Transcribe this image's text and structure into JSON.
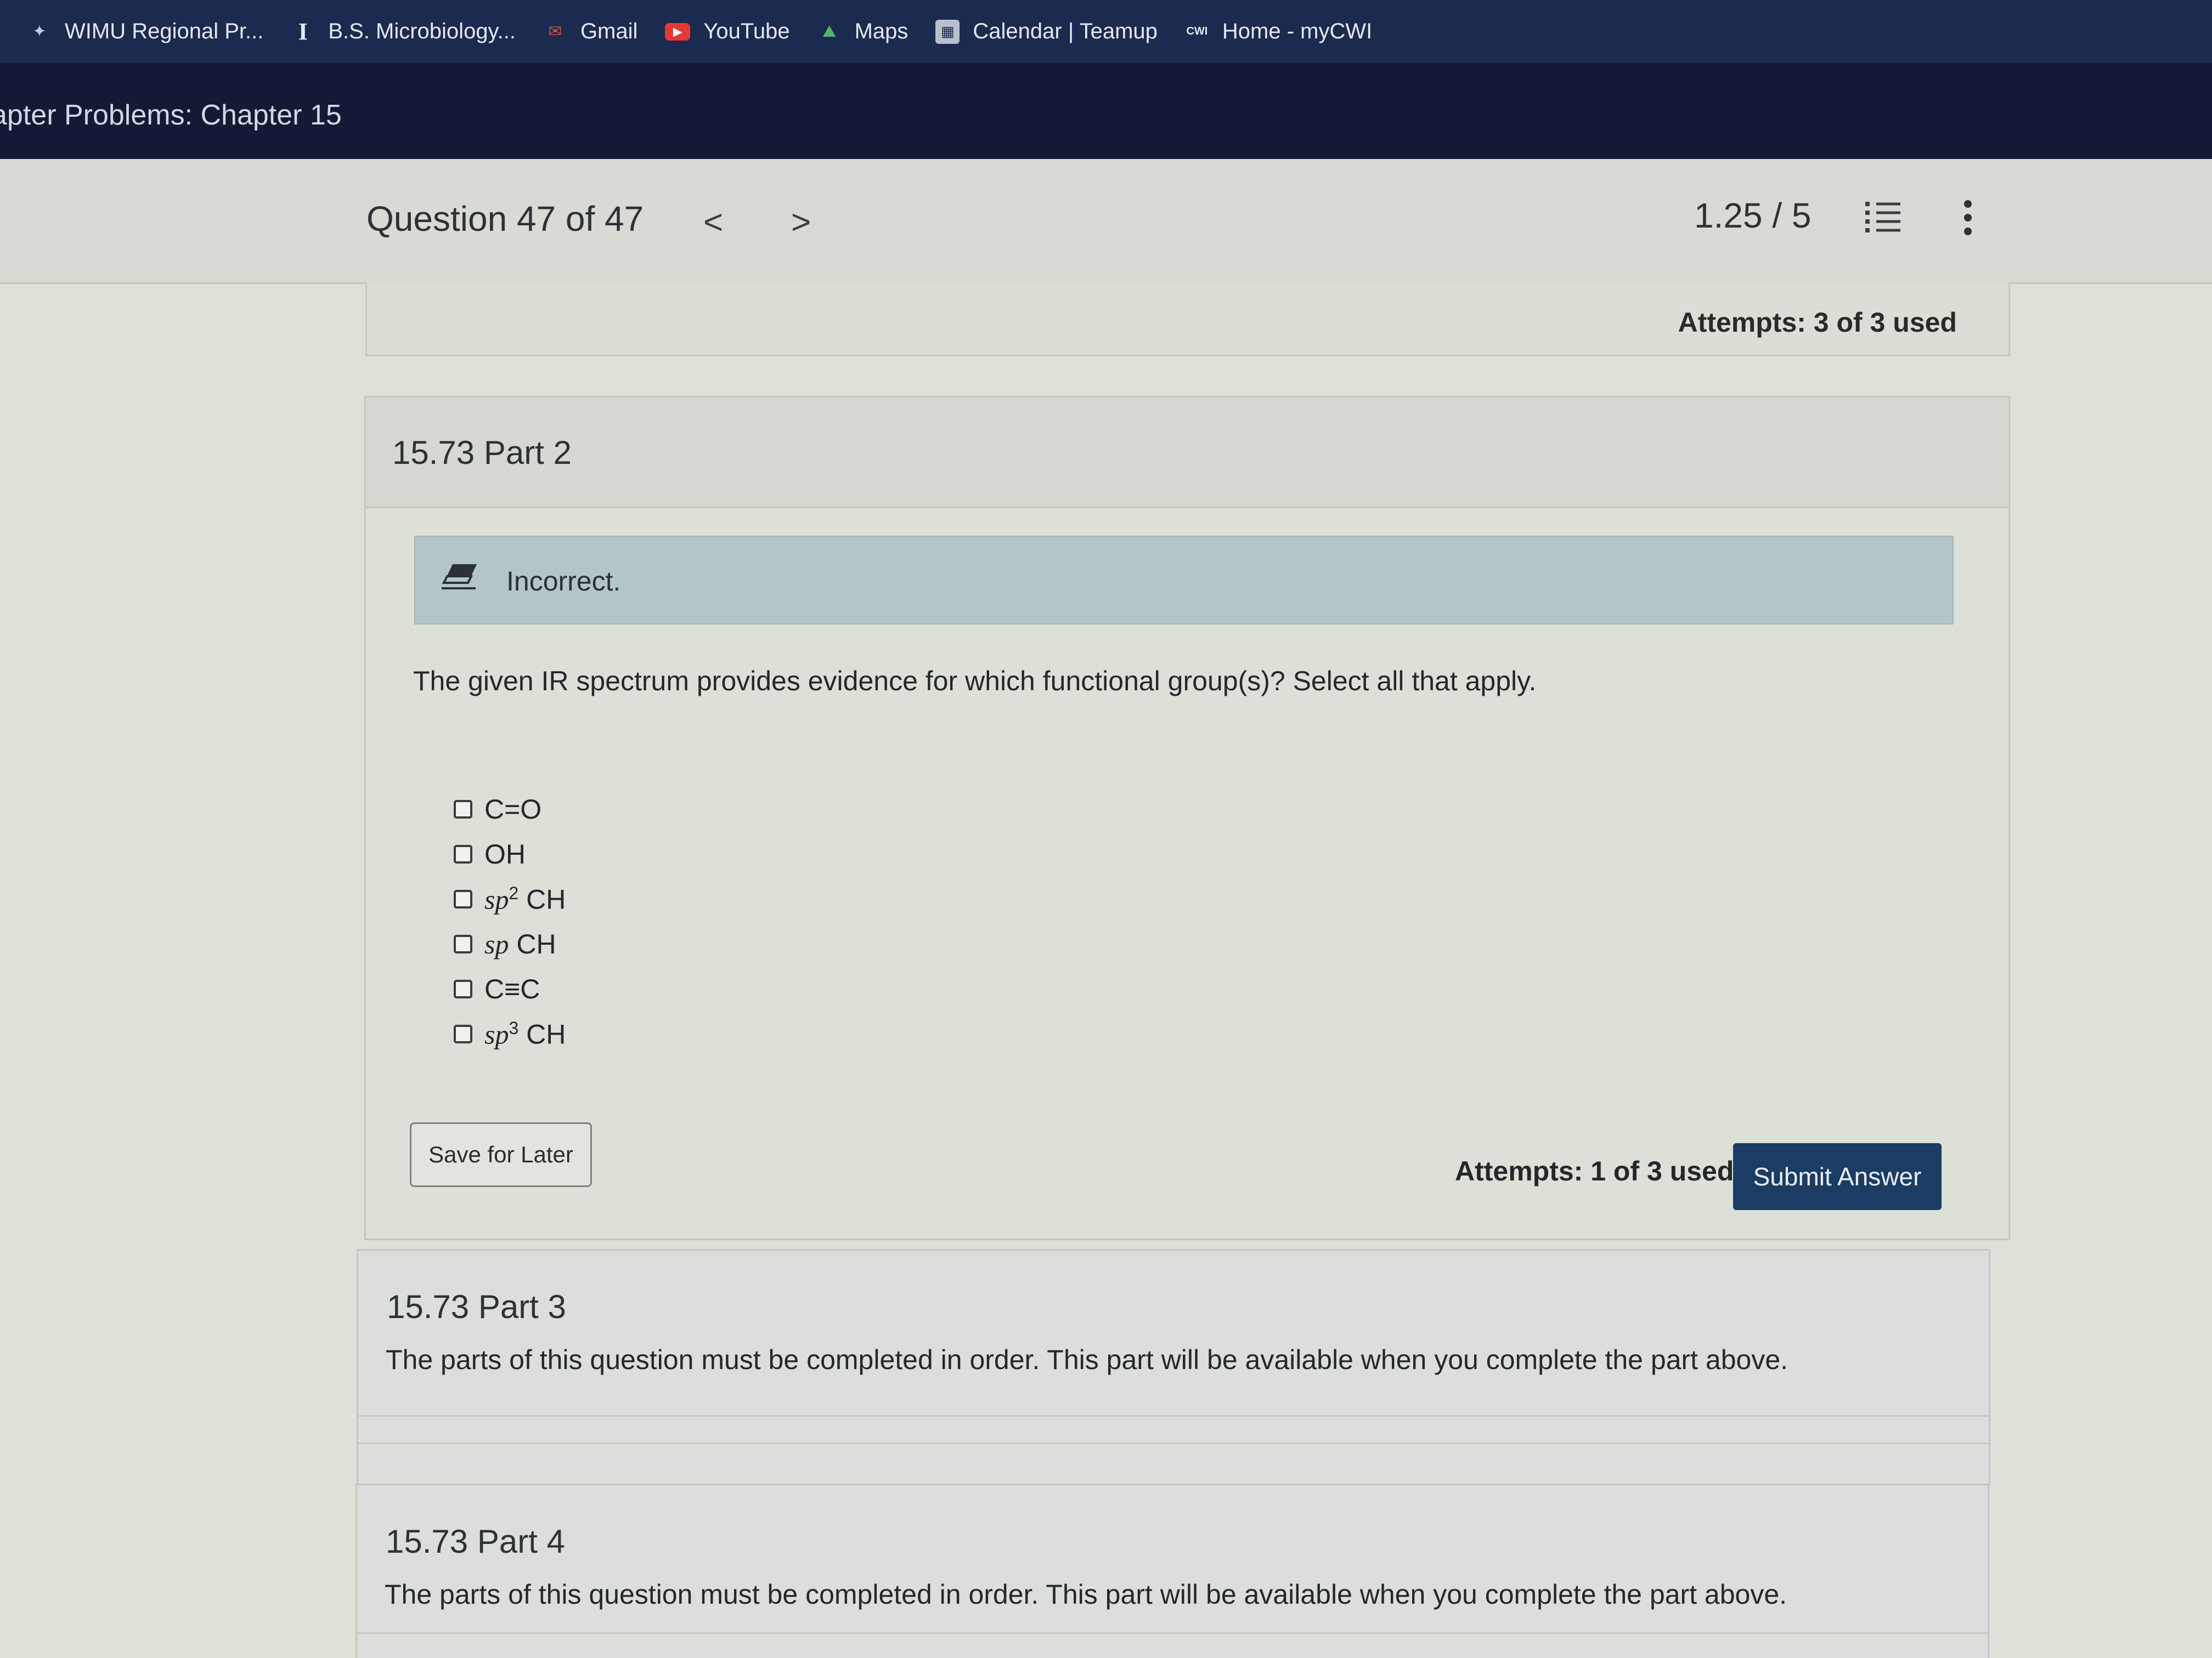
{
  "bookmarks": [
    {
      "label": "WIMU Regional Pr...",
      "icon": "wimu-icon"
    },
    {
      "label": "B.S. Microbiology...",
      "icon": "i-book-icon"
    },
    {
      "label": "Gmail",
      "icon": "gmail-icon"
    },
    {
      "label": "YouTube",
      "icon": "youtube-icon"
    },
    {
      "label": "Maps",
      "icon": "maps-icon"
    },
    {
      "label": "Calendar | Teamup",
      "icon": "calendar-icon"
    },
    {
      "label": "Home - myCWI",
      "icon": "cwi-icon",
      "icon_text": "CWI"
    }
  ],
  "course": {
    "title": "apter Problems: Chapter 15"
  },
  "question_header": {
    "title": "Question 47 of 47",
    "prev_glyph": "<",
    "next_glyph": ">",
    "score": "1.25 / 5"
  },
  "attempts_top": "Attempts: 3 of 3 used",
  "part2": {
    "title": "15.73 Part 2",
    "feedback": "Incorrect.",
    "prompt": "The given IR spectrum provides evidence for which functional group(s)? Select all that apply.",
    "choices": [
      {
        "text": "C=O",
        "checked": false
      },
      {
        "text": "OH",
        "checked": false
      },
      {
        "pre": "sp",
        "sup": "2",
        "post": " CH",
        "checked": false
      },
      {
        "pre": "sp",
        "post": " CH",
        "checked": false
      },
      {
        "text": "C≡C",
        "checked": false
      },
      {
        "pre": "sp",
        "sup": "3",
        "post": " CH",
        "checked": false
      }
    ],
    "save_label": "Save for Later",
    "attempts": "Attempts: 1 of 3 used",
    "submit_label": "Submit Answer"
  },
  "part3": {
    "title": "15.73 Part 3",
    "note": "The parts of this question must be completed in order. This part will be available when you complete the part above."
  },
  "part4": {
    "title": "15.73 Part 4",
    "note": "The parts of this question must be completed in order. This part will be available when you complete the part above."
  },
  "colors": {
    "bookmark_bar": "#1b2b4f",
    "course_bar": "#141a35",
    "submit_button": "#1b3c63",
    "feedback_bg": "#b3c5c7"
  }
}
